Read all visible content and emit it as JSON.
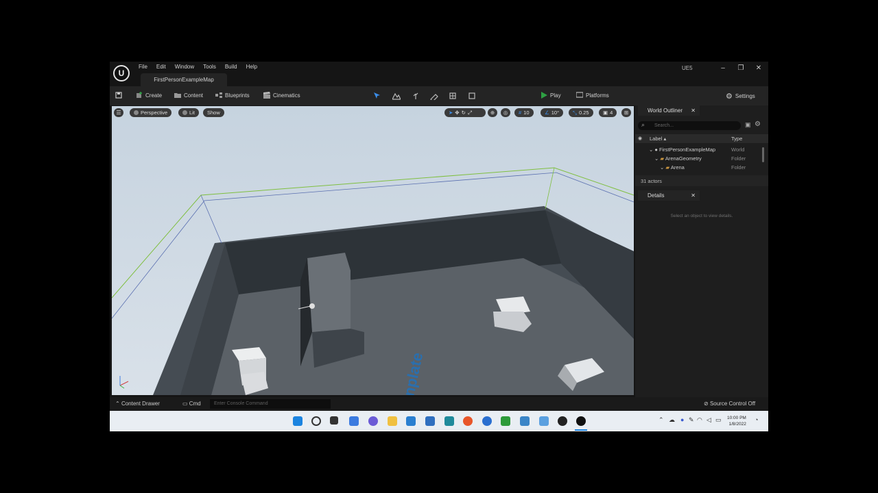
{
  "window": {
    "menu": [
      "File",
      "Edit",
      "Window",
      "Tools",
      "Build",
      "Help"
    ],
    "map_tab": "FirstPersonExampleMap",
    "engine_label": "UE5"
  },
  "toolbar": {
    "create": "Create",
    "content": "Content",
    "blueprints": "Blueprints",
    "cinematics": "Cinematics",
    "play": "Play",
    "platforms": "Platforms",
    "settings": "Settings"
  },
  "viewport": {
    "perspective": "Perspective",
    "lit": "Lit",
    "show": "Show",
    "grid_snap": "10",
    "rotation_snap": "10°",
    "scale_snap": "0.25",
    "camera_speed": "4",
    "floor_text": "nplate"
  },
  "outliner": {
    "tab": "World Outliner",
    "search_placeholder": "Search...",
    "col_label": "Label",
    "col_type": "Type",
    "rows": [
      {
        "label": "FirstPersonExampleMap",
        "type": "World"
      },
      {
        "label": "ArenaGeometry",
        "type": "Folder"
      },
      {
        "label": "Arena",
        "type": "Folder"
      }
    ],
    "actor_count": "31 actors"
  },
  "details": {
    "tab": "Details",
    "empty_text": "Select an object to view details."
  },
  "statusbar": {
    "content_drawer": "Content Drawer",
    "cmd": "Cmd",
    "console_placeholder": "Enter Console Command",
    "source_control": "Source Control Off"
  },
  "taskbar": {
    "time": "10:00 PM",
    "date": "1/8/2022"
  },
  "colors": {
    "accent": "#0070e0",
    "play": "#2ea043",
    "sky": "#c9d6e2",
    "wall": "#3f464d",
    "floor": "#5a6066"
  }
}
